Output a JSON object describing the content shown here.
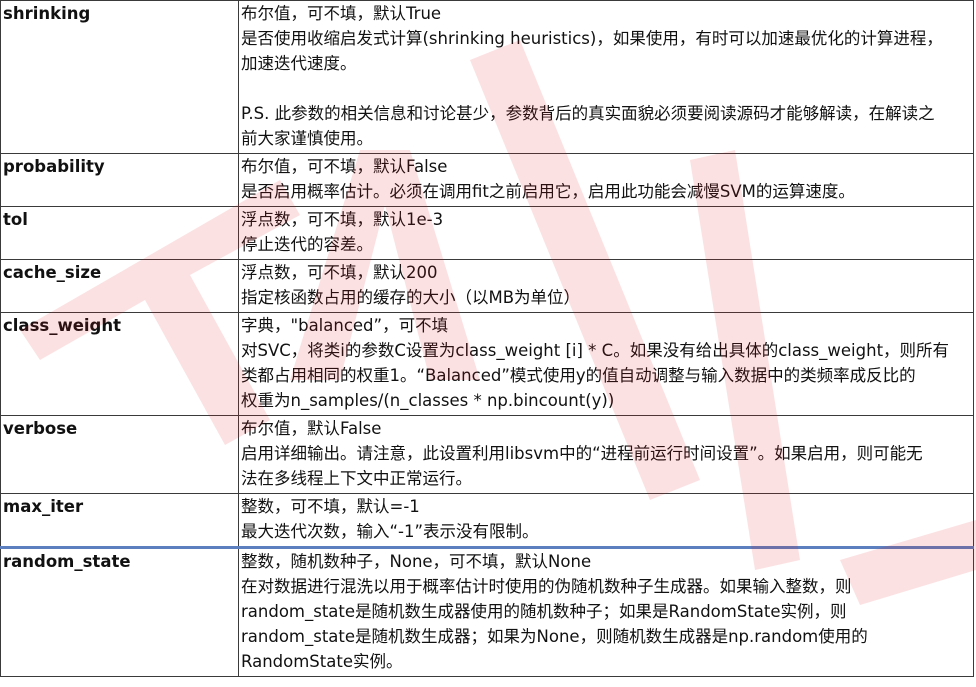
{
  "rows": [
    {
      "name": "shrinking",
      "lines": [
        "布尔值，可不填，默认True",
        "是否使用收缩启发式计算(shrinking heuristics)，如果使用，有时可以加速最优化的计算进程，",
        "加速迭代速度。",
        "",
        "P.S. 此参数的相关信息和讨论甚少，参数背后的真实面貌必须要阅读源码才能够解读，在解读之",
        "前大家谨慎使用。"
      ]
    },
    {
      "name": "probability",
      "lines": [
        "布尔值，可不填，默认False",
        "是否启用概率估计。必须在调用fit之前启用它，启用此功能会减慢SVM的运算速度。"
      ]
    },
    {
      "name": "tol",
      "lines": [
        "浮点数，可不填，默认1e-3",
        "停止迭代的容差。"
      ]
    },
    {
      "name": "cache_size",
      "lines": [
        "浮点数，可不填，默认200",
        "指定核函数占用的缓存的大小（以MB为单位）"
      ]
    },
    {
      "name": "class_weight",
      "lines": [
        "字典，\"balanced”，可不填",
        "对SVC，将类i的参数C设置为class_weight [i] * C。如果没有给出具体的class_weight，则所有",
        "类都占用相同的权重1。“Balanced”模式使用y的值自动调整与输入数据中的类频率成反比的",
        "权重为n_samples/(n_classes * np.bincount(y))"
      ]
    },
    {
      "name": "verbose",
      "lines": [
        "布尔值，默认False",
        "启用详细输出。请注意，此设置利用libsvm中的“进程前运行时间设置”。如果启用，则可能无",
        "法在多线程上下文中正常运行。"
      ]
    },
    {
      "name": "max_iter",
      "lines": [
        "整数，可不填，默认=-1",
        "最大迭代次数，输入“-1”表示没有限制。"
      ]
    },
    {
      "name": "random_state",
      "lines": [
        "整数，随机数种子，None，可不填，默认None",
        "在对数据进行混洗以用于概率估计时使用的伪随机数种子生成器。如果输入整数，则",
        "random_state是随机数生成器使用的随机数种子；如果是RandomState实例，则",
        "random_state是随机数生成器；如果为None，则随机数生成器是np.random使用的",
        "RandomState实例。"
      ]
    }
  ],
  "watermark": {
    "color": "#e8141c"
  }
}
